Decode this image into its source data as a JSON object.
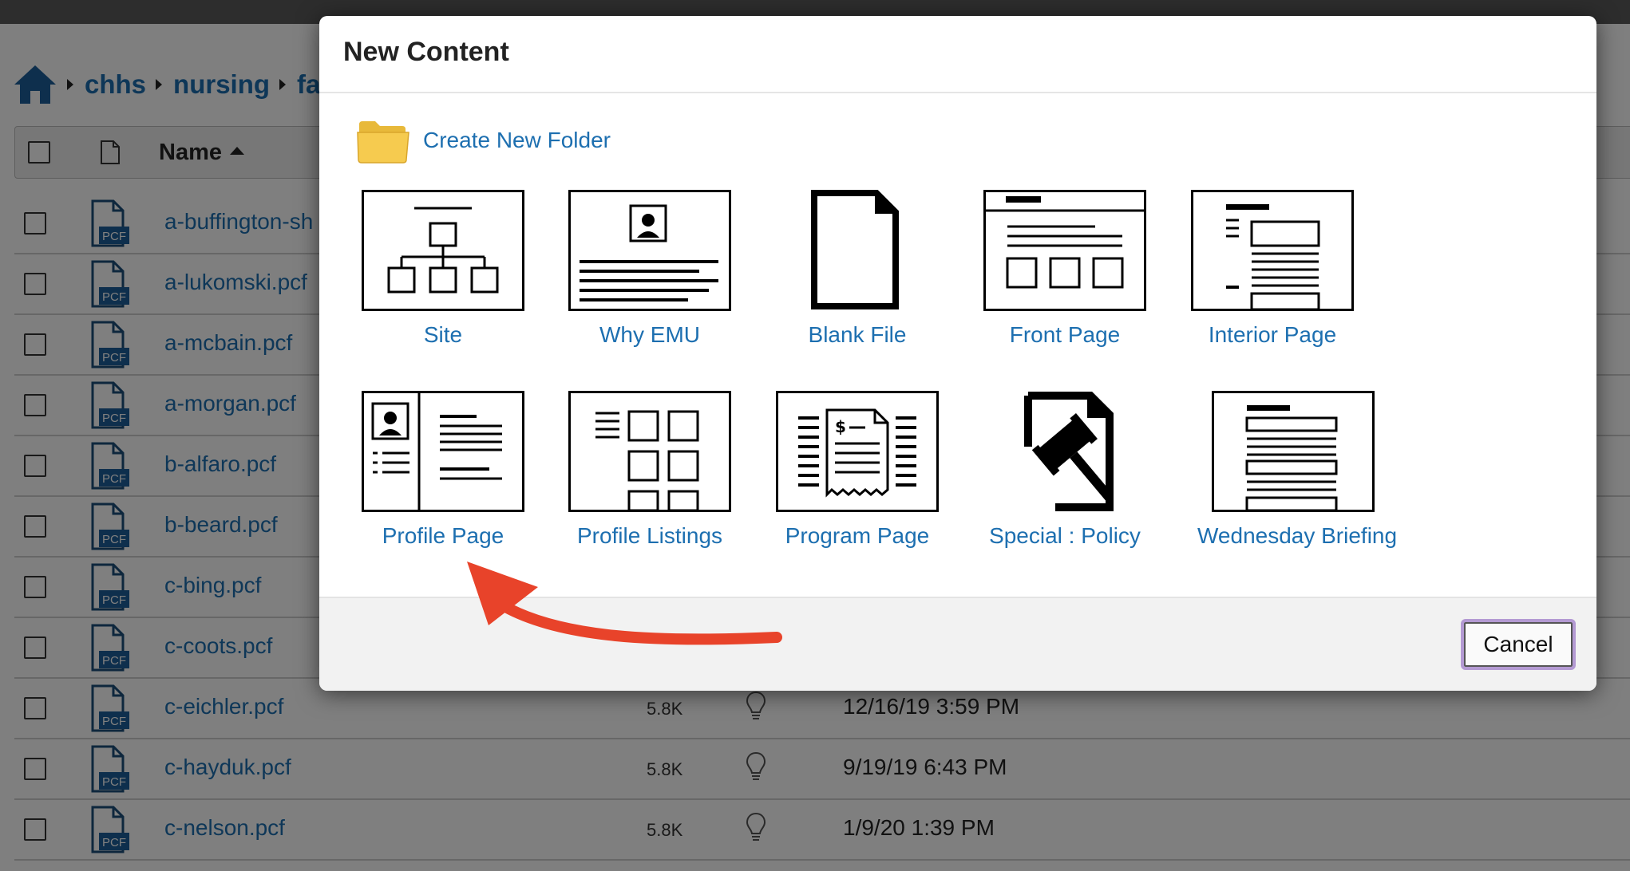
{
  "breadcrumb": {
    "items": [
      "chhs",
      "nursing",
      "fa"
    ]
  },
  "table": {
    "name_header": "Name",
    "rows": [
      {
        "name": "a-buffington-sh",
        "size": "",
        "date": ""
      },
      {
        "name": "a-lukomski.pcf",
        "size": "",
        "date": ""
      },
      {
        "name": "a-mcbain.pcf",
        "size": "",
        "date": ""
      },
      {
        "name": "a-morgan.pcf",
        "size": "",
        "date": ""
      },
      {
        "name": "b-alfaro.pcf",
        "size": "",
        "date": ""
      },
      {
        "name": "b-beard.pcf",
        "size": "",
        "date": ""
      },
      {
        "name": "c-bing.pcf",
        "size": "",
        "date": ""
      },
      {
        "name": "c-coots.pcf",
        "size": "",
        "date": ""
      },
      {
        "name": "c-eichler.pcf",
        "size": "5.8K",
        "date": "12/16/19 3:59 PM"
      },
      {
        "name": "c-hayduk.pcf",
        "size": "5.8K",
        "date": "9/19/19 6:43 PM"
      },
      {
        "name": "c-nelson.pcf",
        "size": "5.8K",
        "date": "1/9/20 1:39 PM"
      }
    ],
    "file_badge": "PCF"
  },
  "modal": {
    "title": "New Content",
    "create_folder_label": "Create New Folder",
    "templates": [
      {
        "label": "Site",
        "icon": "site-icon"
      },
      {
        "label": "Why EMU",
        "icon": "why-emu-icon"
      },
      {
        "label": "Blank File",
        "icon": "blank-file-icon"
      },
      {
        "label": "Front Page",
        "icon": "front-page-icon"
      },
      {
        "label": "Interior Page",
        "icon": "interior-page-icon"
      },
      {
        "label": "Profile Page",
        "icon": "profile-page-icon"
      },
      {
        "label": "Profile Listings",
        "icon": "profile-listings-icon"
      },
      {
        "label": "Program Page",
        "icon": "program-page-icon"
      },
      {
        "label": "Special : Policy",
        "icon": "special-policy-icon"
      },
      {
        "label": "Wednesday Briefing",
        "icon": "wednesday-briefing-icon"
      }
    ],
    "cancel_label": "Cancel",
    "program_page_glyph": "$"
  },
  "colors": {
    "link": "#1d6fb0",
    "annotation_arrow": "#e8432a",
    "cancel_focus_ring": "#b49ad3"
  }
}
